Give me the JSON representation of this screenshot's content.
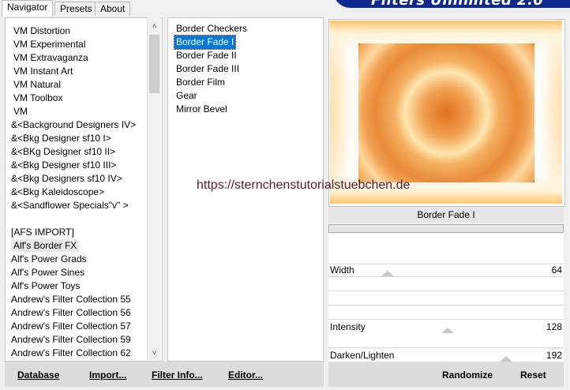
{
  "tabs": [
    "Navigator",
    "Presets",
    "About"
  ],
  "banner": {
    "title": "Filters Unlimited 2.0"
  },
  "categories": [
    "VM Distortion",
    "VM Experimental",
    "VM Extravaganza",
    "VM Instant Art",
    "VM Natural",
    "VM Toolbox",
    "VM",
    "&<Background Designers IV>",
    "&<Bkg Designer sf10 I>",
    "&<BKg Designer sf10 II>",
    "&<Bkg Designer sf10 III>",
    "&<Bkg Designers sf10 IV>",
    "&<Bkg Kaleidoscope>",
    "&<Sandflower Specials\"v\" >",
    "",
    "[AFS IMPORT]",
    "Alf's Border FX",
    "Alf's Power Grads",
    "Alf's Power Sines",
    "Alf's Power Toys",
    "Andrew's Filter Collection 55",
    "Andrew's Filter Collection 56",
    "Andrew's Filter Collection 57",
    "Andrew's Filter Collection 59",
    "Andrew's Filter Collection 62"
  ],
  "selected_category": "Alf's Border FX",
  "filters": [
    "Border Checkers",
    "Border Fade I",
    "Border Fade II",
    "Border Fade III",
    "Border Film",
    "Gear",
    "Mirror Bevel"
  ],
  "selected_filter": "Border Fade I",
  "watermark": "https://sternchenstutorialstuebchen.de",
  "filter_name": "Border Fade I",
  "params": [
    {
      "label": "Width",
      "value": "64"
    },
    {
      "label": "Intensity",
      "value": "128"
    },
    {
      "label": "Darken/Lighten",
      "value": "192"
    }
  ],
  "buttons": {
    "database": "Database",
    "import": "Import...",
    "filter_info": "Filter Info...",
    "editor": "Editor...",
    "randomize": "Randomize",
    "reset": "Reset"
  },
  "icons": {
    "scroll_up": "chevron-up-icon",
    "scroll_down": "chevron-down-icon"
  },
  "colors": {
    "selection": "#0078d7",
    "banner": "#0f2a8c",
    "preview_center": "#e07020"
  }
}
